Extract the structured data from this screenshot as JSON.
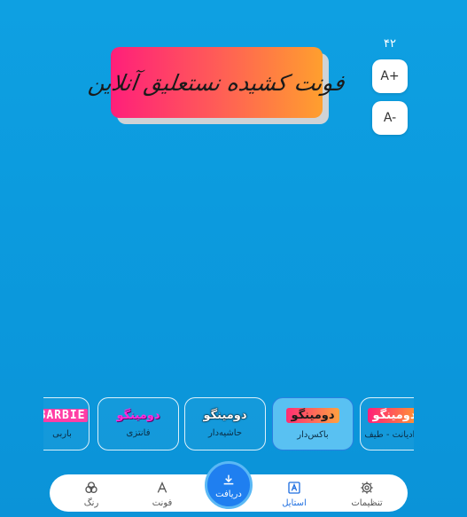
{
  "preview": {
    "text": "فونت کشیده نستعلیق آنلاین"
  },
  "size": {
    "value": "۴۲",
    "increase_label": "A+",
    "decrease_label": "A-"
  },
  "styles": [
    {
      "sample": "دومینگو",
      "label": "گرادیانت - طیف"
    },
    {
      "sample": "دومینگو",
      "label": "باکس‌دار"
    },
    {
      "sample": "دومینگو",
      "label": "حاشیه‌دار"
    },
    {
      "sample": "دومینگو",
      "label": "فانتزی"
    },
    {
      "sample": "BARBIE",
      "label": "باربی"
    }
  ],
  "nav": {
    "settings_label": "تنظیمات",
    "style_label": "استایل",
    "download_label": "دریافت",
    "font_label": "فونت",
    "color_label": "رنگ"
  }
}
